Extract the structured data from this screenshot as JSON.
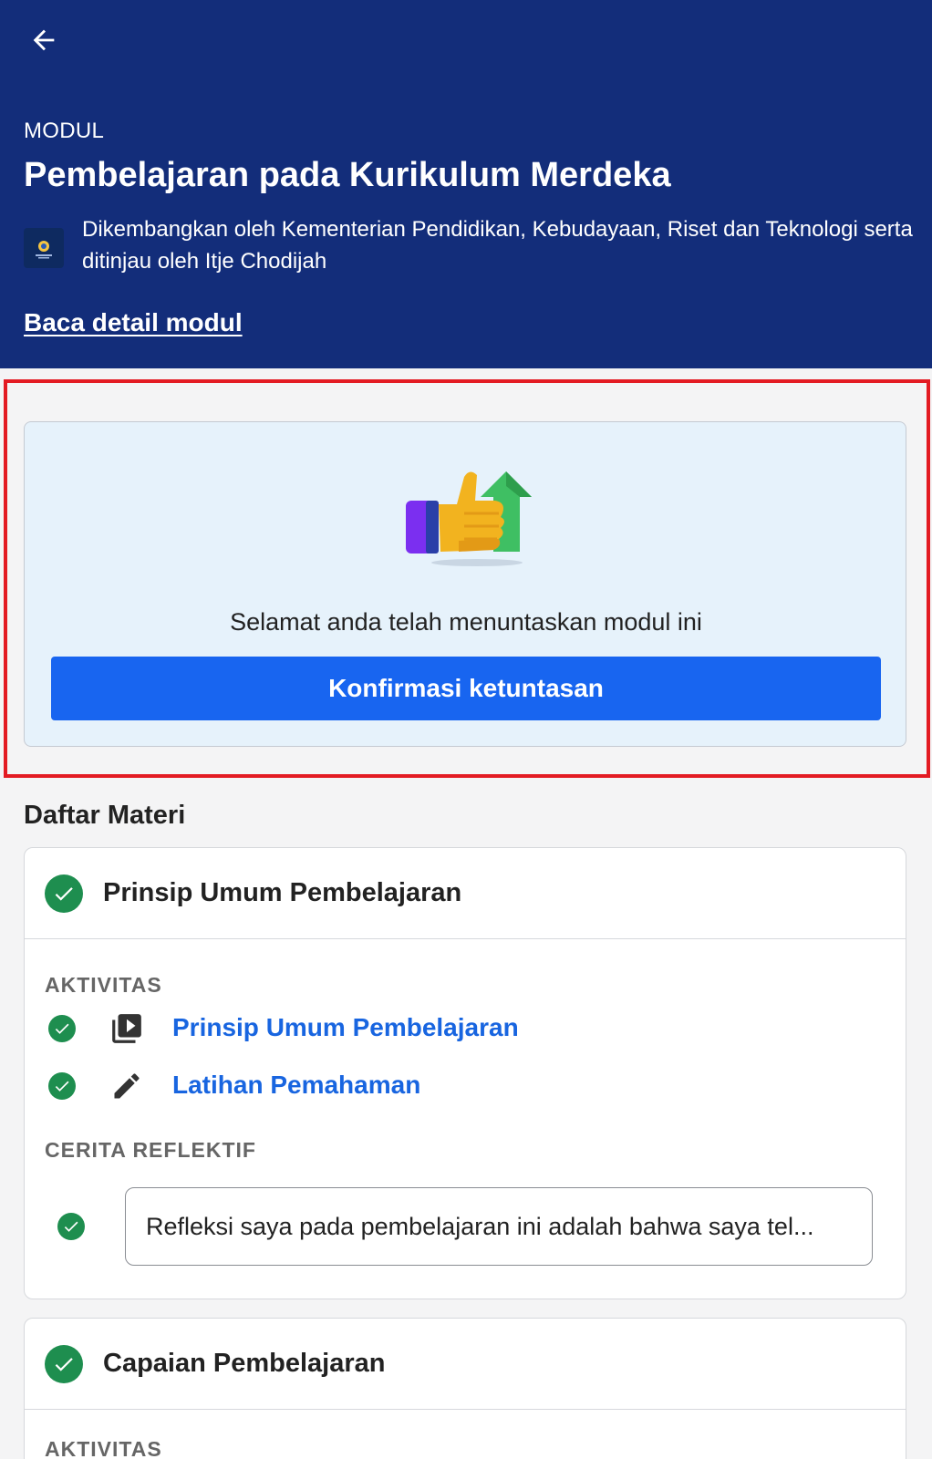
{
  "header": {
    "back_icon": "arrow-left-icon",
    "kicker": "MODUL",
    "title": "Pembelajaran pada Kurikulum Merdeka",
    "developer_text": "Dikembangkan oleh Kementerian Pendidikan, Kebudayaan, Riset dan Teknologi serta ditinjau oleh Itje Chodijah",
    "detail_link": "Baca detail modul",
    "background_color": "#132d7a"
  },
  "completion": {
    "illustration": "thumbs-up-growth-icon",
    "message": "Selamat anda telah menuntaskan modul ini",
    "button_label": "Konfirmasi ketuntasan",
    "button_color": "#1865f0",
    "highlight_color": "#e31b23"
  },
  "materials": {
    "heading": "Daftar Materi",
    "items": [
      {
        "title": "Prinsip Umum Pembelajaran",
        "completed": true,
        "activities_label": "AKTIVITAS",
        "activities": [
          {
            "label": "Prinsip Umum Pembelajaran",
            "icon": "video-library-icon",
            "completed": true
          },
          {
            "label": "Latihan Pemahaman",
            "icon": "pencil-icon",
            "completed": true
          }
        ],
        "reflection_label": "CERITA REFLEKTIF",
        "reflection_text": "Refleksi saya pada pembelajaran ini adalah bahwa saya tel...",
        "reflection_completed": true
      },
      {
        "title": "Capaian Pembelajaran",
        "completed": true,
        "activities_label": "AKTIVITAS"
      }
    ]
  },
  "colors": {
    "success": "#1e8e4f",
    "link": "#1865e0"
  }
}
